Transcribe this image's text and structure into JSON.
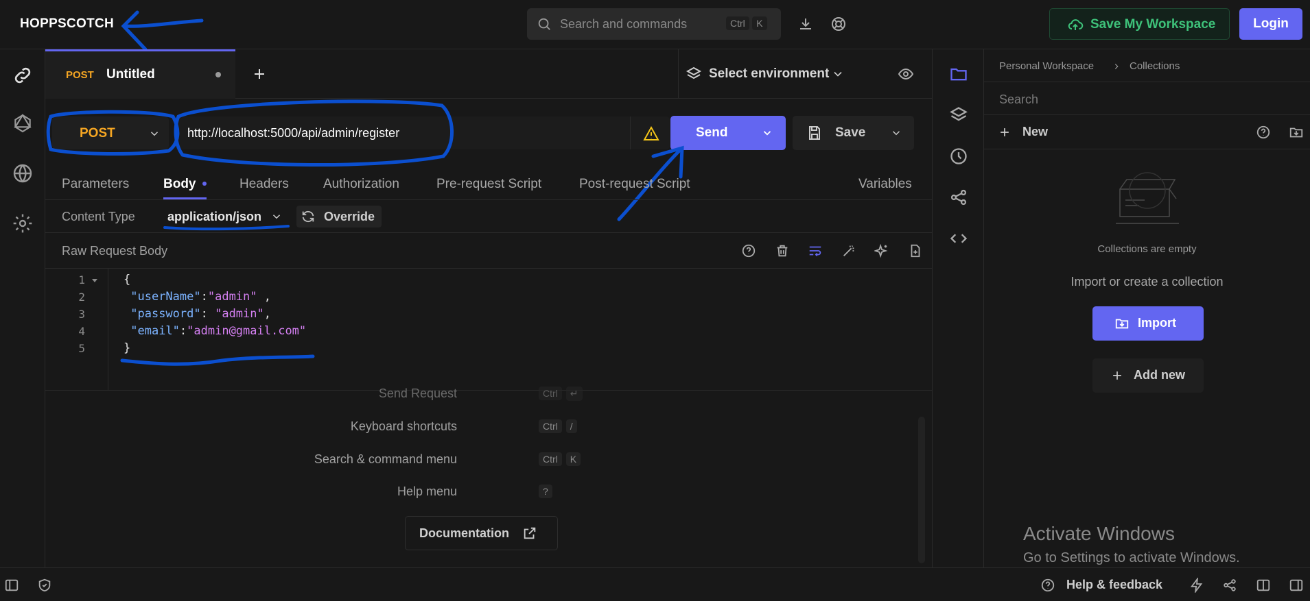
{
  "app": {
    "logo": "HOPPSCOTCH"
  },
  "header": {
    "search_placeholder": "Search and commands",
    "search_kbd1": "Ctrl",
    "search_kbd2": "K",
    "save_workspace": "Save My Workspace",
    "login": "Login"
  },
  "tab": {
    "method": "POST",
    "title": "Untitled"
  },
  "environment": {
    "label": "Select environment"
  },
  "request": {
    "method": "POST",
    "url": "http://localhost:5000/api/admin/register",
    "send": "Send",
    "save": "Save"
  },
  "subtabs": [
    "Parameters",
    "Body",
    "Headers",
    "Authorization",
    "Pre-request Script",
    "Post-request Script",
    "Variables"
  ],
  "content_type": {
    "label": "Content Type",
    "value": "application/json",
    "override": "Override"
  },
  "raw_body": {
    "label": "Raw Request Body"
  },
  "editor": {
    "line_numbers": [
      "1",
      "2",
      "3",
      "4",
      "5"
    ],
    "lines": [
      {
        "text": "{"
      },
      {
        "key": "\"userName\"",
        "sep": ":",
        "val": "\"admin\"",
        "tail": " ,"
      },
      {
        "key": "\"password\"",
        "sep": ": ",
        "val": "\"admin\"",
        "tail": ","
      },
      {
        "key": "\"email\"",
        "sep": ":",
        "val": "\"admin@gmail.com\"",
        "tail": ""
      },
      {
        "text": "}"
      }
    ]
  },
  "shortcuts": [
    {
      "label": "Send Request",
      "keys": [
        "Ctrl",
        "↵"
      ]
    },
    {
      "label": "Keyboard shortcuts",
      "keys": [
        "Ctrl",
        "/"
      ]
    },
    {
      "label": "Search & command menu",
      "keys": [
        "Ctrl",
        "K"
      ]
    },
    {
      "label": "Help menu",
      "keys": [
        "?"
      ]
    }
  ],
  "documentation": "Documentation",
  "panel": {
    "breadcrumb_1": "Personal Workspace",
    "breadcrumb_2": "Collections",
    "search_placeholder": "Search",
    "new_label": "New",
    "empty_text": "Collections are empty",
    "import_hint": "Import or create a collection",
    "import_btn": "Import",
    "add_new_btn": "Add new"
  },
  "watermark": {
    "title": "Activate Windows",
    "subtitle": "Go to Settings to activate Windows."
  },
  "footer": {
    "help": "Help & feedback"
  },
  "colors": {
    "accent": "#6366f1",
    "method": "#f5a623",
    "green": "#3ec27a",
    "annotation": "#0b4fcf"
  }
}
